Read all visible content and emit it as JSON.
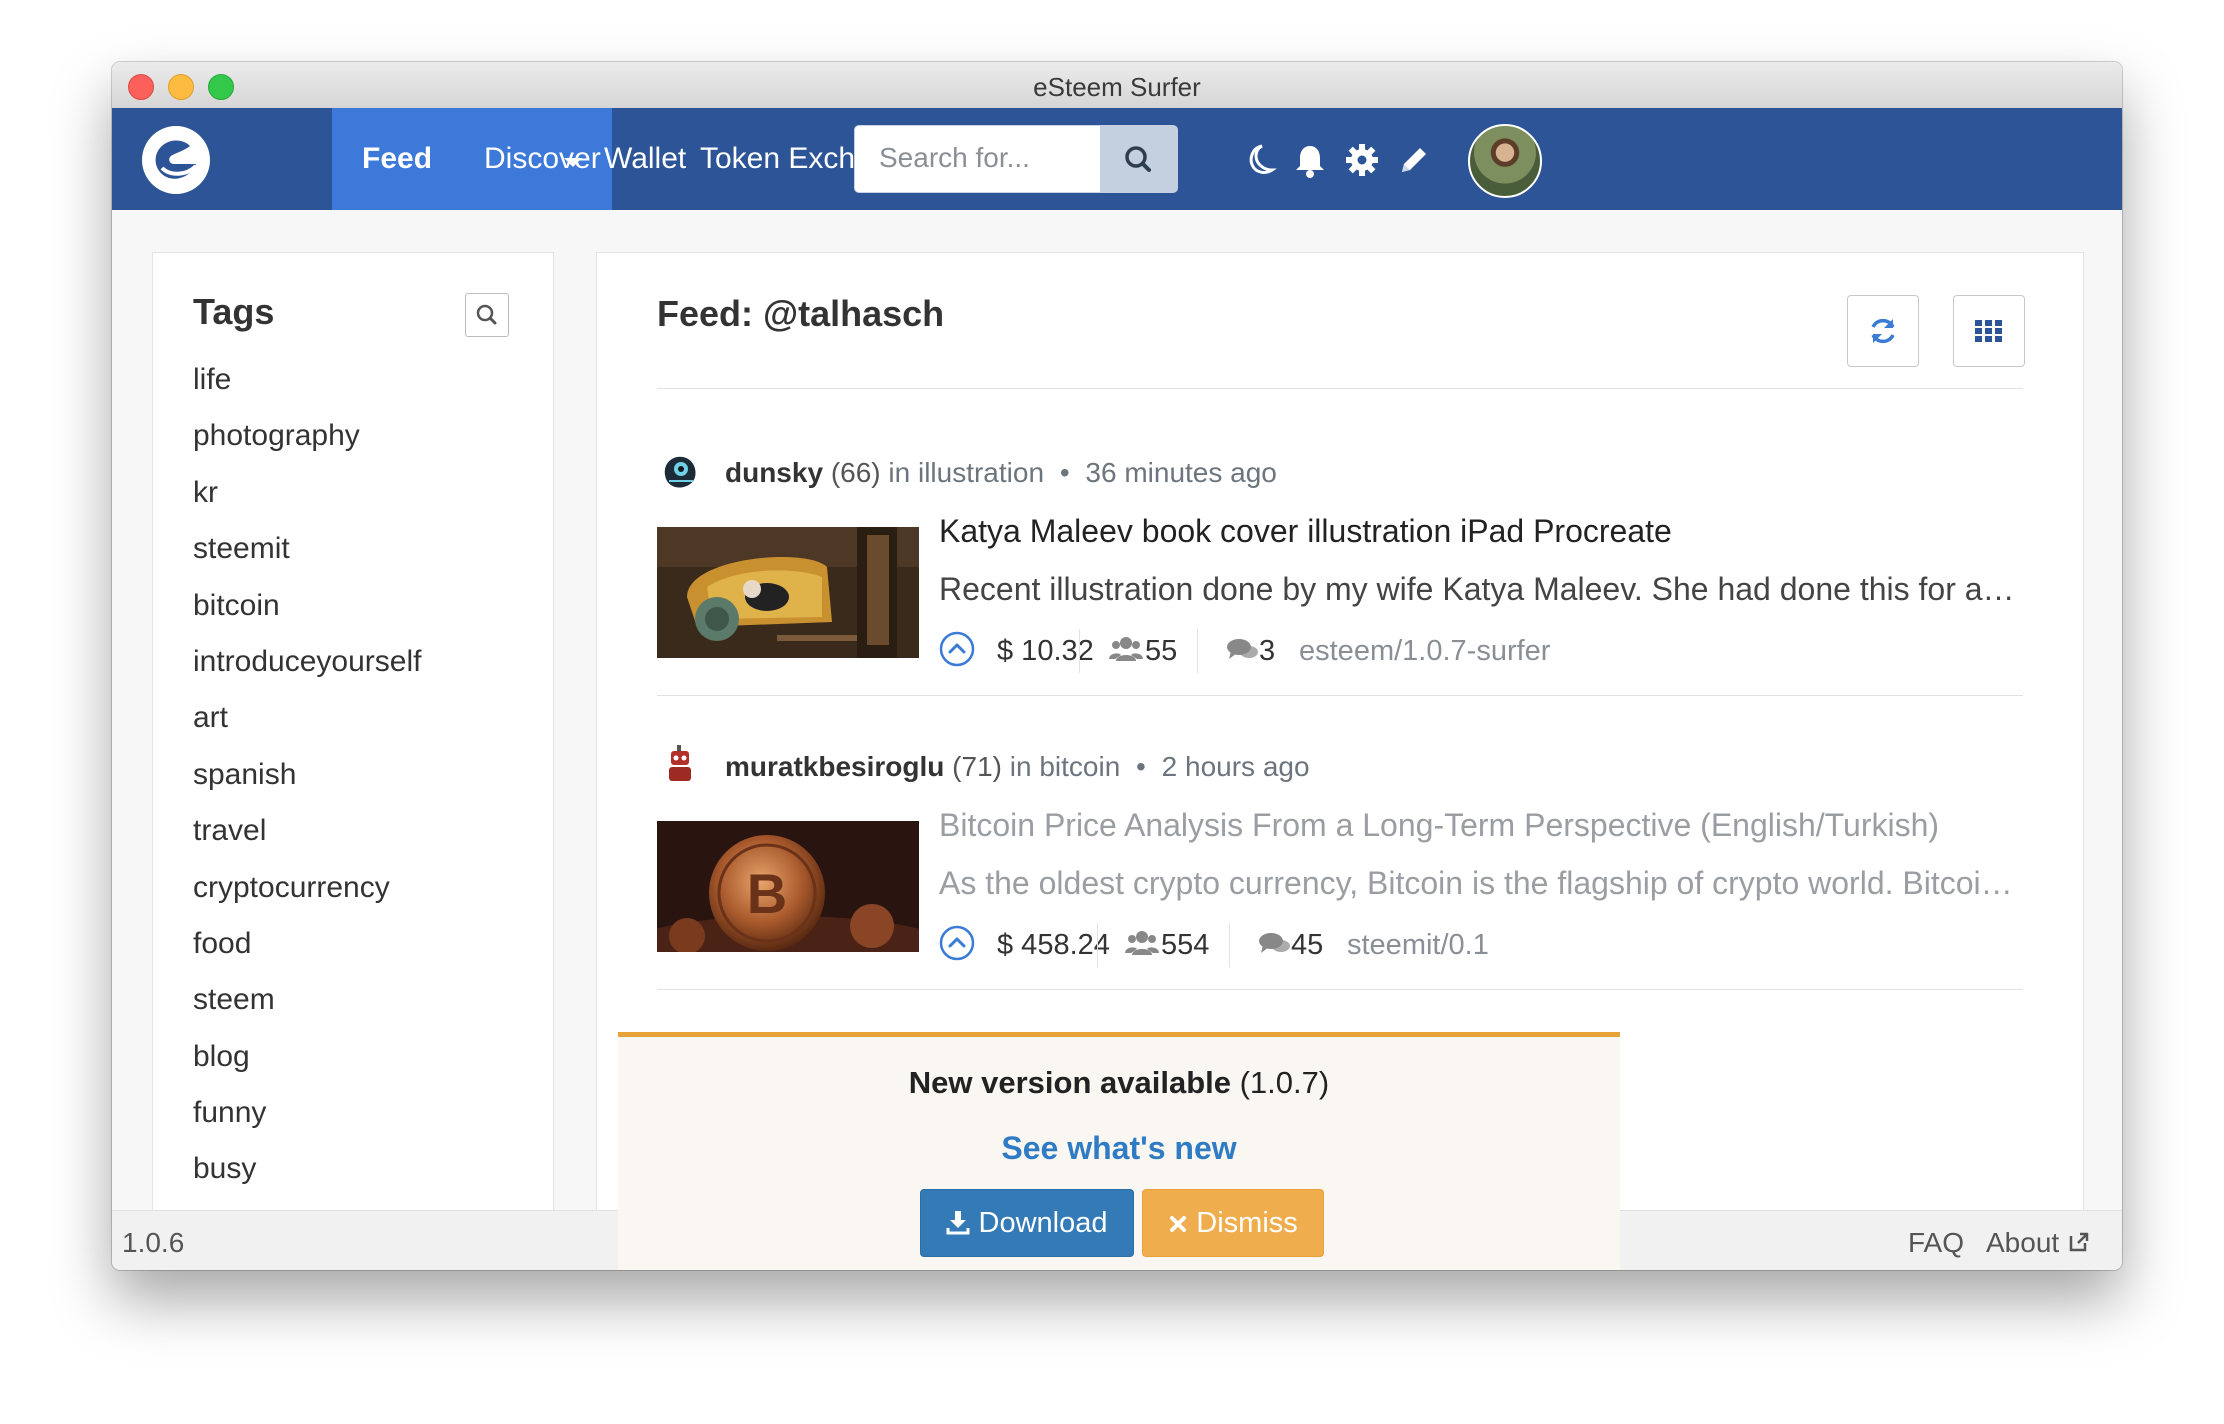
{
  "window": {
    "title": "eSteem Surfer"
  },
  "navbar": {
    "feed_label": "Feed",
    "links": [
      "Discover",
      "Wallet",
      "Token Exchange"
    ],
    "search_placeholder": "Search for...",
    "icons": [
      "moon-icon",
      "bell-icon",
      "gear-icon",
      "pencil-icon"
    ],
    "brand_color": "#2c5496",
    "active_color": "#3d79d8"
  },
  "tags": {
    "title": "Tags",
    "items": [
      "life",
      "photography",
      "kr",
      "steemit",
      "bitcoin",
      "introduceyourself",
      "art",
      "spanish",
      "travel",
      "cryptocurrency",
      "food",
      "steem",
      "blog",
      "funny",
      "busy"
    ]
  },
  "feed": {
    "title": "Feed: @talhasch",
    "posts": [
      {
        "author": "dunsky",
        "reputation": "(66)",
        "in_label": "in",
        "category": "illustration",
        "time": "36 minutes ago",
        "title": "Katya Maleev book cover illustration iPad Procreate",
        "body": "Recent illustration done by my wife Katya Maleev. She had done this for a book cover.",
        "payout": "$ 10.32",
        "votes": "55",
        "comments": "3",
        "app": "esteem/1.0.7-surfer"
      },
      {
        "author": "muratkbesiroglu",
        "reputation": "(71)",
        "in_label": "in",
        "category": "bitcoin",
        "time": "2 hours ago",
        "title": "Bitcoin Price Analysis From a Long-Term Perspective (English/Turkish)",
        "body": "As the oldest crypto currency, Bitcoin is the flagship of crypto world. Bitcoin price analysis...",
        "payout": "$ 458.24",
        "votes": "554",
        "comments": "45",
        "app": "steemit/0.1"
      }
    ]
  },
  "update": {
    "headline": "New version available",
    "version": "(1.0.7)",
    "link": "See what's new",
    "download_label": "Download",
    "dismiss_label": "Dismiss"
  },
  "status": {
    "version": "1.0.6",
    "faq": "FAQ",
    "about": "About"
  }
}
